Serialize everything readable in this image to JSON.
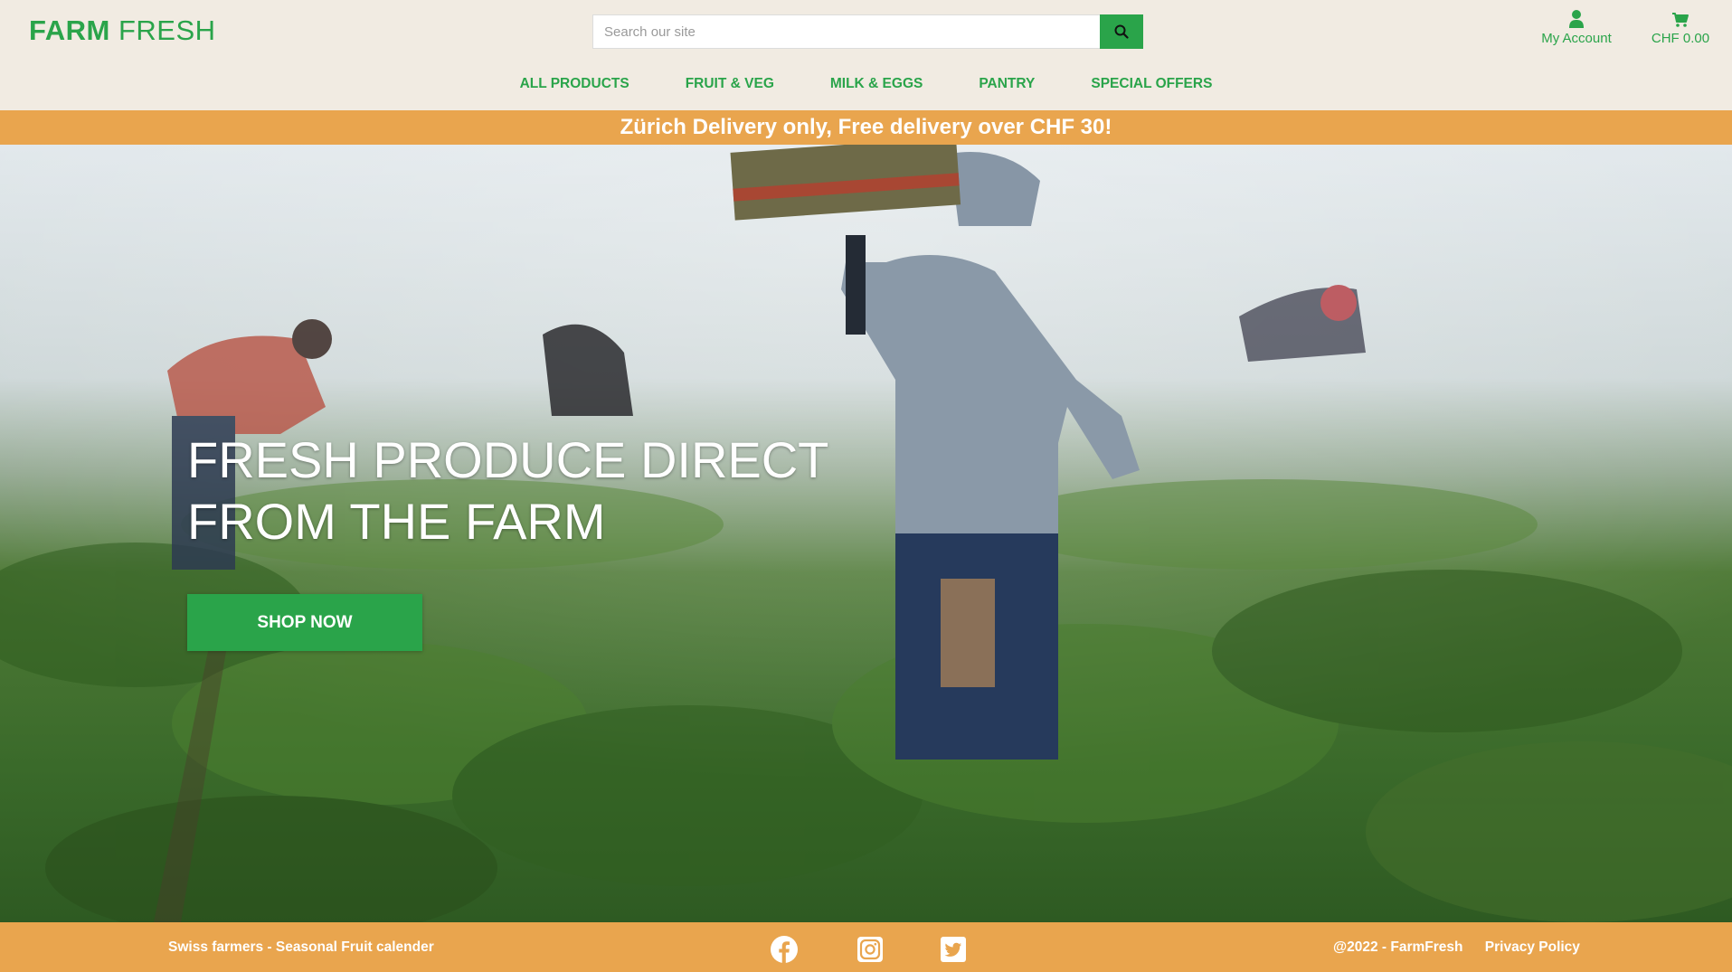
{
  "brand": {
    "bold": "FARM",
    "rest": "FRESH"
  },
  "search": {
    "placeholder": "Search our site",
    "button_icon": "search-icon"
  },
  "account": {
    "label": "My Account",
    "icon": "user-icon"
  },
  "cart": {
    "label": "CHF 0.00",
    "icon": "cart-icon"
  },
  "nav": {
    "items": [
      {
        "label": "ALL PRODUCTS"
      },
      {
        "label": "FRUIT & VEG"
      },
      {
        "label": "MILK & EGGS"
      },
      {
        "label": "PANTRY"
      },
      {
        "label": "SPECIAL OFFERS"
      }
    ]
  },
  "banner": {
    "text": "Zürich Delivery only, Free delivery over CHF 30!"
  },
  "hero": {
    "title_line1": "FRESH PRODUCE DIRECT",
    "title_line2": "FROM THE FARM",
    "button": "SHOP NOW"
  },
  "footer": {
    "left_link": "Swiss farmers - Seasonal Fruit calender",
    "social": [
      "facebook-icon",
      "instagram-icon",
      "twitter-icon"
    ],
    "copyright": "@2022 - FarmFresh",
    "privacy": "Privacy Policy"
  },
  "colors": {
    "brand_green": "#2aa44a",
    "accent_orange": "#e9a54e",
    "header_bg": "#f1ebe2"
  }
}
